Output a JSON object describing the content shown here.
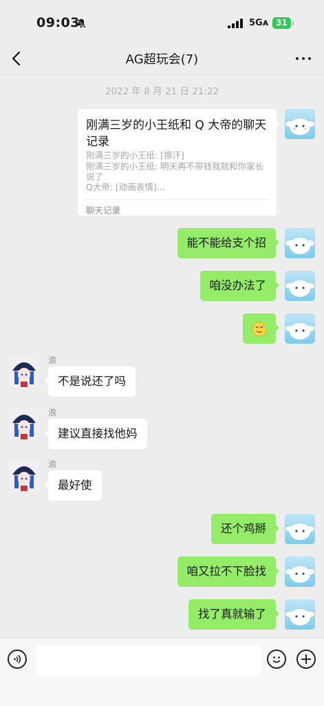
{
  "status": {
    "time": "09:03",
    "network": "5Gᴀ",
    "battery": "31"
  },
  "nav": {
    "title": "AG超玩会(7)"
  },
  "chat": {
    "timestamp": "2022 年 8 月 21 日 21:22",
    "card": {
      "title": "刚满三岁的小王纸和 Q 大帝的聊天记录",
      "lines": [
        "刚满三岁的小王纸: [擦汗]",
        "刚满三岁的小王纸: 明天再不带钱我就和你家长",
        "说了",
        "Q大帝: [动画表情]..."
      ],
      "footer": "聊天记录"
    },
    "messages": [
      {
        "side": "self",
        "text": "能不能给支个招"
      },
      {
        "side": "self",
        "text": "咱没办法了"
      },
      {
        "side": "self",
        "text": "",
        "emoji": "sweat-smile-emoji"
      },
      {
        "side": "other",
        "sender": "浪",
        "text": "不是说还了吗"
      },
      {
        "side": "other",
        "sender": "浪",
        "text": "建议直接找他妈"
      },
      {
        "side": "other",
        "sender": "浪",
        "text": "最好使"
      },
      {
        "side": "self",
        "text": "还个鸡掰"
      },
      {
        "side": "self",
        "text": "咱又拉不下脸找"
      },
      {
        "side": "self",
        "text": "找了真就输了"
      }
    ]
  },
  "input": {
    "placeholder": ""
  },
  "colors": {
    "self_bubble": "#95ec69",
    "other_bubble": "#ffffff",
    "background": "#ededed"
  },
  "icons": [
    "bell-slash-icon",
    "signal-icon",
    "back-icon",
    "more-icon",
    "voice-icon",
    "emoji-icon",
    "plus-icon"
  ]
}
